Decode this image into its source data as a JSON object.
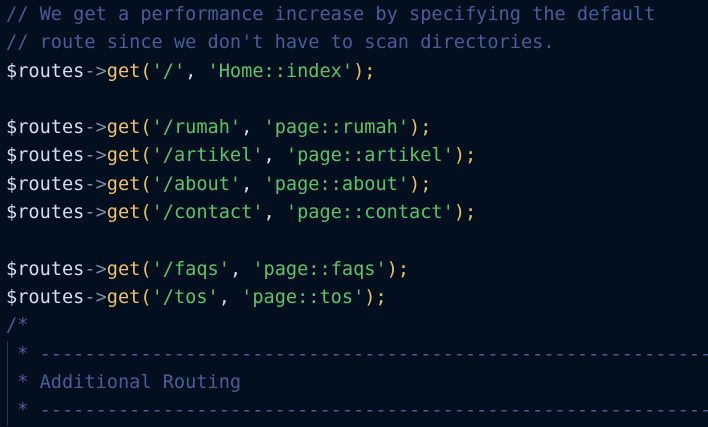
{
  "code": {
    "comment_line_1": "// We get a performance increase by specifying the default",
    "comment_line_2": "// route since we don't have to scan directories.",
    "routes": [
      {
        "path": "'/'",
        "handler": "'Home::index'"
      },
      {
        "path": "'/rumah'",
        "handler": "'page::rumah'"
      },
      {
        "path": "'/artikel'",
        "handler": "'page::artikel'"
      },
      {
        "path": "'/about'",
        "handler": "'page::about'"
      },
      {
        "path": "'/contact'",
        "handler": "'page::contact'"
      },
      {
        "path": "'/faqs'",
        "handler": "'page::faqs'"
      },
      {
        "path": "'/tos'",
        "handler": "'page::tos'"
      }
    ],
    "variable": "$routes",
    "arrow": "->",
    "method": "get",
    "open_paren": "(",
    "separator": ", ",
    "close": ");",
    "block_comment_start": "/*",
    "divider": " * --------------------------------------------------------------------",
    "block_title": " * Additional Routing"
  },
  "colors": {
    "background": "#010f1e",
    "comment": "#4b5c98",
    "string": "#5ac46a",
    "function": "#f5c063",
    "variable": "#d6deeb"
  }
}
